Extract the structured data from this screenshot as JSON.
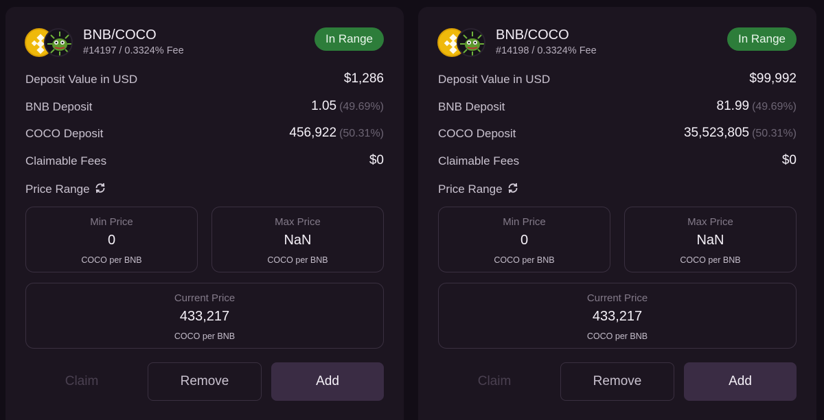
{
  "cards": [
    {
      "pair": "BNB/COCO",
      "position_id": "#14197",
      "fee": "0.3324% Fee",
      "status": "In Range",
      "rows": {
        "deposit_value": {
          "label": "Deposit Value in USD",
          "value": "$1,286"
        },
        "bnb_deposit": {
          "label": "BNB Deposit",
          "value": "1.05",
          "pct": "(49.69%)"
        },
        "coco_deposit": {
          "label": "COCO Deposit",
          "value": "456,922",
          "pct": "(50.31%)"
        },
        "claimable_fees": {
          "label": "Claimable Fees",
          "value": "$0"
        },
        "price_range": {
          "label": "Price Range"
        }
      },
      "min_price": {
        "title": "Min Price",
        "value": "0",
        "unit": "COCO per BNB"
      },
      "max_price": {
        "title": "Max Price",
        "value": "NaN",
        "unit": "COCO per BNB"
      },
      "current_price": {
        "title": "Current Price",
        "value": "433,217",
        "unit": "COCO per BNB"
      },
      "buttons": {
        "claim": "Claim",
        "remove": "Remove",
        "add": "Add"
      }
    },
    {
      "pair": "BNB/COCO",
      "position_id": "#14198",
      "fee": "0.3324% Fee",
      "status": "In Range",
      "rows": {
        "deposit_value": {
          "label": "Deposit Value in USD",
          "value": "$99,992"
        },
        "bnb_deposit": {
          "label": "BNB Deposit",
          "value": "81.99",
          "pct": "(49.69%)"
        },
        "coco_deposit": {
          "label": "COCO Deposit",
          "value": "35,523,805",
          "pct": "(50.31%)"
        },
        "claimable_fees": {
          "label": "Claimable Fees",
          "value": "$0"
        },
        "price_range": {
          "label": "Price Range"
        }
      },
      "min_price": {
        "title": "Min Price",
        "value": "0",
        "unit": "COCO per BNB"
      },
      "max_price": {
        "title": "Max Price",
        "value": "NaN",
        "unit": "COCO per BNB"
      },
      "current_price": {
        "title": "Current Price",
        "value": "433,217",
        "unit": "COCO per BNB"
      },
      "buttons": {
        "claim": "Claim",
        "remove": "Remove",
        "add": "Add"
      }
    }
  ],
  "icons": {
    "token_a": "bnb-token-icon",
    "token_b": "coco-token-icon",
    "refresh": "refresh-icon"
  },
  "colors": {
    "background": "#120d16",
    "card": "#1c1520",
    "in_range_badge": "#2d7d3a",
    "add_button": "#3a2c44"
  }
}
